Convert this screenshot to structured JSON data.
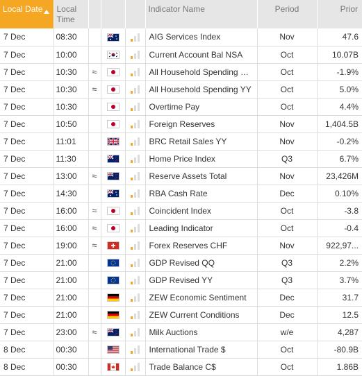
{
  "header": {
    "local_date": "Local Date",
    "local_time": "Local Time",
    "indicator_name": "Indicator Name",
    "period": "Period",
    "prior": "Prior"
  },
  "colors": {
    "accent": "#f5a623",
    "header_bg": "#e6e6e6"
  },
  "rows": [
    {
      "date": "7 Dec",
      "time": "08:30",
      "approx": "",
      "flag": "au",
      "importance": "low",
      "name": "AIG Services Index",
      "period": "Nov",
      "prior": "47.6"
    },
    {
      "date": "7 Dec",
      "time": "10:00",
      "approx": "",
      "flag": "kr",
      "importance": "low",
      "name": "Current Account Bal NSA",
      "period": "Oct",
      "prior": "10.07B"
    },
    {
      "date": "7 Dec",
      "time": "10:30",
      "approx": "≈",
      "flag": "jp",
      "importance": "low",
      "name": "All Household Spending MM",
      "period": "Oct",
      "prior": "-1.9%"
    },
    {
      "date": "7 Dec",
      "time": "10:30",
      "approx": "≈",
      "flag": "jp",
      "importance": "low",
      "name": "All Household Spending YY",
      "period": "Oct",
      "prior": "5.0%"
    },
    {
      "date": "7 Dec",
      "time": "10:30",
      "approx": "",
      "flag": "jp",
      "importance": "low",
      "name": "Overtime Pay",
      "period": "Oct",
      "prior": "4.4%"
    },
    {
      "date": "7 Dec",
      "time": "10:50",
      "approx": "",
      "flag": "jp",
      "importance": "low",
      "name": "Foreign Reserves",
      "period": "Nov",
      "prior": "1,404.5B"
    },
    {
      "date": "7 Dec",
      "time": "11:01",
      "approx": "",
      "flag": "gb",
      "importance": "low",
      "name": "BRC Retail Sales YY",
      "period": "Nov",
      "prior": "-0.2%"
    },
    {
      "date": "7 Dec",
      "time": "11:30",
      "approx": "",
      "flag": "nz",
      "importance": "low",
      "name": "Home Price Index",
      "period": "Q3",
      "prior": "6.7%"
    },
    {
      "date": "7 Dec",
      "time": "13:00",
      "approx": "≈",
      "flag": "nz",
      "importance": "low",
      "name": "Reserve Assets Total",
      "period": "Nov",
      "prior": "23,426M"
    },
    {
      "date": "7 Dec",
      "time": "14:30",
      "approx": "",
      "flag": "au",
      "importance": "low",
      "name": "RBA Cash Rate",
      "period": "Dec",
      "prior": "0.10%"
    },
    {
      "date": "7 Dec",
      "time": "16:00",
      "approx": "≈",
      "flag": "jp",
      "importance": "low",
      "name": "Coincident Index",
      "period": "Oct",
      "prior": "-3.8"
    },
    {
      "date": "7 Dec",
      "time": "16:00",
      "approx": "≈",
      "flag": "jp",
      "importance": "low",
      "name": "Leading Indicator",
      "period": "Oct",
      "prior": "-0.4"
    },
    {
      "date": "7 Dec",
      "time": "19:00",
      "approx": "≈",
      "flag": "ch",
      "importance": "low",
      "name": "Forex Reserves CHF",
      "period": "Nov",
      "prior": "922,97..."
    },
    {
      "date": "7 Dec",
      "time": "21:00",
      "approx": "",
      "flag": "eu",
      "importance": "low",
      "name": "GDP Revised QQ",
      "period": "Q3",
      "prior": "2.2%"
    },
    {
      "date": "7 Dec",
      "time": "21:00",
      "approx": "",
      "flag": "eu",
      "importance": "low",
      "name": "GDP Revised YY",
      "period": "Q3",
      "prior": "3.7%"
    },
    {
      "date": "7 Dec",
      "time": "21:00",
      "approx": "",
      "flag": "de",
      "importance": "low",
      "name": "ZEW Economic Sentiment",
      "period": "Dec",
      "prior": "31.7"
    },
    {
      "date": "7 Dec",
      "time": "21:00",
      "approx": "",
      "flag": "de",
      "importance": "low",
      "name": "ZEW Current Conditions",
      "period": "Dec",
      "prior": "12.5"
    },
    {
      "date": "7 Dec",
      "time": "23:00",
      "approx": "≈",
      "flag": "nz",
      "importance": "low",
      "name": "Milk Auctions",
      "period": "w/e",
      "prior": "4,287"
    },
    {
      "date": "8 Dec",
      "time": "00:30",
      "approx": "",
      "flag": "us",
      "importance": "low",
      "name": "International Trade $",
      "period": "Oct",
      "prior": "-80.9B"
    },
    {
      "date": "8 Dec",
      "time": "00:30",
      "approx": "",
      "flag": "ca",
      "importance": "low",
      "name": "Trade Balance C$",
      "period": "Oct",
      "prior": "1.86B"
    }
  ]
}
